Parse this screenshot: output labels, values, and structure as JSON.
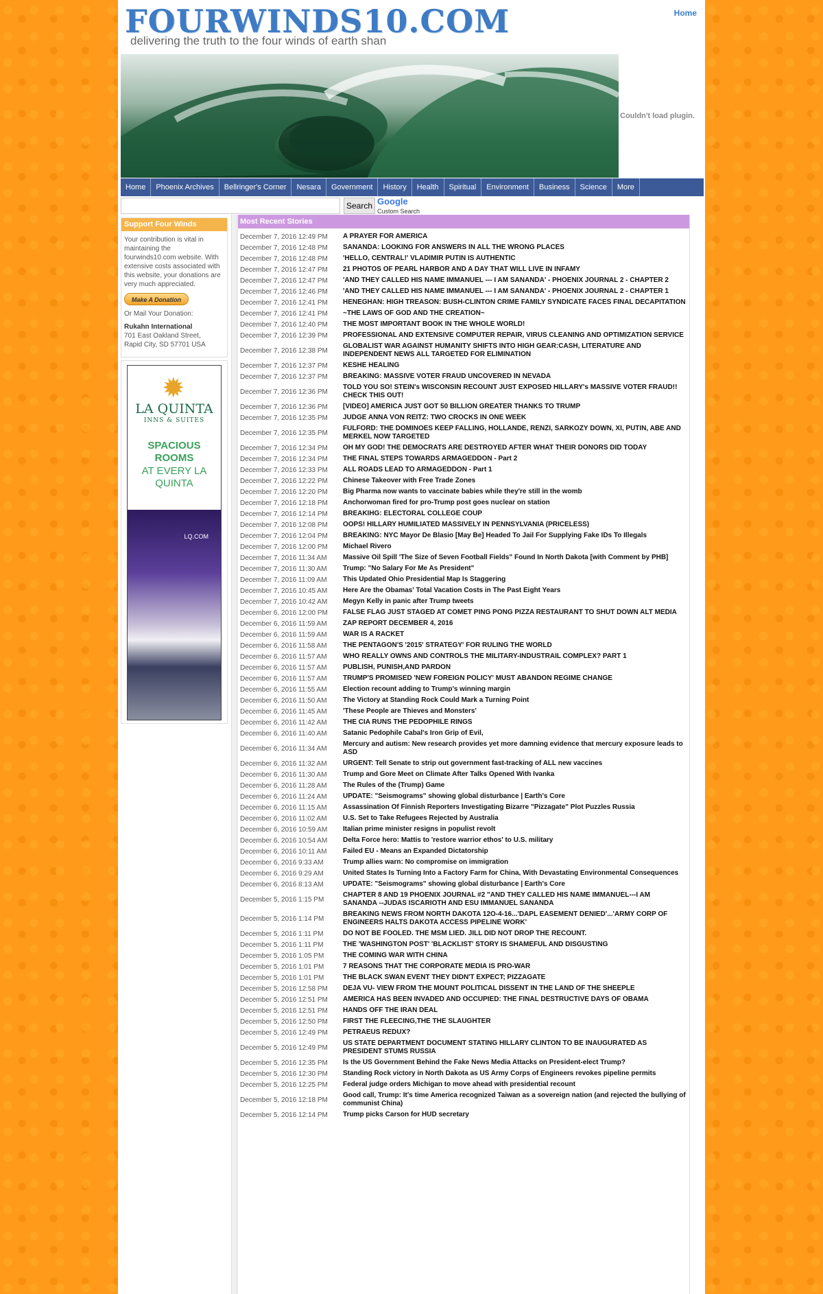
{
  "header": {
    "site_title": "FOURWINDS10.COM",
    "tagline": "delivering the truth to the four winds of earth shan",
    "home_link": "Home",
    "plugin_message": "Couldn't load plugin."
  },
  "nav": {
    "items": [
      "Home",
      "Phoenix Archives",
      "Bellringer's Corner",
      "Nesara",
      "Government",
      "History",
      "Health",
      "Spiritual",
      "Environment",
      "Business",
      "Science",
      "More"
    ]
  },
  "search": {
    "button_label": "Search",
    "google_label": "Google",
    "custom_label": "Custom Search"
  },
  "sidebar": {
    "title": "Support Four Winds",
    "intro": "Your contribution is vital in maintaining the fourwinds10.com website. With extensive costs associated with this website, your donations are very much appreciated.",
    "donate_label": "Make A Donation",
    "mail_label": "Or Mail Your Donation:",
    "address_name": "Rukahn International",
    "address_line1": "701 East Oakland Street,",
    "address_line2": "Rapid City, SD 57701 USA"
  },
  "ad": {
    "brand": "LA QUINTA",
    "brand_sub": "INNS & SUITES",
    "headline": "SPACIOUS ROOMS",
    "headline2": "AT EVERY LA QUINTA",
    "url": "LQ.COM"
  },
  "stories": {
    "title": "Most Recent Stories",
    "items": [
      {
        "date": "December 7, 2016 12:49 PM",
        "title": "A PRAYER FOR AMERICA"
      },
      {
        "date": "December 7, 2016 12:48 PM",
        "title": "SANANDA: LOOKING FOR ANSWERS IN ALL THE WRONG PLACES"
      },
      {
        "date": "December 7, 2016 12:48 PM",
        "title": "'HELLO, CENTRAL!' VLADIMIR PUTIN IS AUTHENTIC"
      },
      {
        "date": "December 7, 2016 12:47 PM",
        "title": "21 PHOTOS OF PEARL HARBOR AND A DAY THAT WILL LIVE IN INFAMY"
      },
      {
        "date": "December 7, 2016 12:47 PM",
        "title": "'AND THEY CALLED HIS NAME IMMANUEL --- I AM SANANDA' - PHOENIX JOURNAL 2 - CHAPTER 2"
      },
      {
        "date": "December 7, 2016 12:46 PM",
        "title": "'AND THEY CALLED HIS NAME IMMANUEL --- I AM SANANDA' - PHOENIX JOURNAL 2 - CHAPTER 1"
      },
      {
        "date": "December 7, 2016 12:41 PM",
        "title": "HENEGHAN: HIGH TREASON: BUSH-CLINTON CRIME FAMILY SYNDICATE FACES FINAL DECAPITATION"
      },
      {
        "date": "December 7, 2016 12:41 PM",
        "title": "~THE LAWS OF GOD AND THE CREATION~"
      },
      {
        "date": "December 7, 2016 12:40 PM",
        "title": "THE MOST IMPORTANT BOOK IN THE WHOLE WORLD!"
      },
      {
        "date": "December 7, 2016 12:39 PM",
        "title": "PROFESSIONAL AND EXTENSIVE COMPUTER REPAIR, VIRUS CLEANING AND OPTIMIZATION SERVICE"
      },
      {
        "date": "December 7, 2016 12:38 PM",
        "title": "GLOBALIST WAR AGAINST HUMANITY SHIFTS INTO HIGH GEAR:CASH, LITERATURE AND INDEPENDENT NEWS ALL TARGETED FOR ELIMINATION"
      },
      {
        "date": "December 7, 2016 12:37 PM",
        "title": "KESHE HEALING"
      },
      {
        "date": "December 7, 2016 12:37 PM",
        "title": "BREAKING: MASSIVE VOTER FRAUD UNCOVERED IN NEVADA"
      },
      {
        "date": "December 7, 2016 12:36 PM",
        "title": "TOLD YOU SO! STEIN's WISCONSIN RECOUNT JUST EXPOSED HILLARY's MASSIVE VOTER FRAUD!! CHECK THIS OUT!"
      },
      {
        "date": "December 7, 2016 12:36 PM",
        "title": "[VIDEO] AMERICA JUST GOT 50 BILLION GREATER THANKS TO TRUMP"
      },
      {
        "date": "December 7, 2016 12:35 PM",
        "title": "JUDGE ANNA VON REITZ: TWO CROCKS IN ONE WEEK"
      },
      {
        "date": "December 7, 2016 12:35 PM",
        "title": "FULFORD: THE DOMINOES KEEP FALLING, HOLLANDE, RENZI, SARKOZY DOWN, XI, PUTIN, ABE AND MERKEL NOW TARGETED"
      },
      {
        "date": "December 7, 2016 12:34 PM",
        "title": "OH MY GOD! THE DEMOCRATS ARE DESTROYED AFTER WHAT THEIR DONORS DID TODAY"
      },
      {
        "date": "December 7, 2016 12:34 PM",
        "title": "THE FINAL STEPS TOWARDS ARMAGEDDON - Part 2"
      },
      {
        "date": "December 7, 2016 12:33 PM",
        "title": "ALL ROADS LEAD TO ARMAGEDDON - Part 1"
      },
      {
        "date": "December 7, 2016 12:22 PM",
        "title": "Chinese Takeover with Free Trade Zones"
      },
      {
        "date": "December 7, 2016 12:20 PM",
        "title": "Big Pharma now wants to vaccinate babies while they're still in the womb"
      },
      {
        "date": "December 7, 2016 12:18 PM",
        "title": "Anchorwoman fired for pro-Trump post goes nuclear on station"
      },
      {
        "date": "December 7, 2016 12:14 PM",
        "title": "BREAKIHG: ELECTORAL COLLEGE COUP"
      },
      {
        "date": "December 7, 2016 12:08 PM",
        "title": "OOPS! HILLARY HUMILIATED MASSIVELY IN PENNSYLVANIA (PRICELESS)"
      },
      {
        "date": "December 7, 2016 12:04 PM",
        "title": "BREAKING: NYC Mayor De Blasio [May Be] Headed To Jail For Supplying Fake IDs To Illegals"
      },
      {
        "date": "December 7, 2016 12:00 PM",
        "title": "Michael Rivero"
      },
      {
        "date": "December 7, 2016 11:34 AM",
        "title": "Massive Oil Spill 'The Size of Seven Football Fields\" Found In North Dakota [with Comment by PHB]"
      },
      {
        "date": "December 7, 2016 11:30 AM",
        "title": "Trump: \"No Salary For Me As President\""
      },
      {
        "date": "December 7, 2016 11:09 AM",
        "title": "This Updated Ohio Presidential Map Is Staggering"
      },
      {
        "date": "December 7, 2016 10:45 AM",
        "title": "Here Are the Obamas' Total Vacation Costs in The Past Eight Years"
      },
      {
        "date": "December 7, 2016 10:42 AM",
        "title": "Megyn Kelly in panic after Trump tweets"
      },
      {
        "date": "December 6, 2016 12:00 PM",
        "title": "FALSE FLAG JUST STAGED AT COMET PING PONG PIZZA RESTAURANT TO SHUT DOWN ALT MEDIA"
      },
      {
        "date": "December 6, 2016 11:59 AM",
        "title": "ZAP REPORT DECEMBER 4, 2016"
      },
      {
        "date": "December 6, 2016 11:59 AM",
        "title": "WAR IS A RACKET"
      },
      {
        "date": "December 6, 2016 11:58 AM",
        "title": "THE PENTAGON'S '2015' STRATEGY' FOR RULING THE WORLD"
      },
      {
        "date": "December 6, 2016 11:57 AM",
        "title": "WHO REALLY OWNS AND CONTROLS THE MILITARY-INDUSTRAIL COMPLEX? PART 1"
      },
      {
        "date": "December 6, 2016 11:57 AM",
        "title": "PUBLISH, PUNISH,AND PARDON"
      },
      {
        "date": "December 6, 2016 11:57 AM",
        "title": "TRUMP'S PROMISED 'NEW FOREIGN POLICY' MUST ABANDON REGIME CHANGE"
      },
      {
        "date": "December 6, 2016 11:55 AM",
        "title": "Election recount adding to Trump's winning margin"
      },
      {
        "date": "December 6, 2016 11:50 AM",
        "title": "The Victory at Standing Rock Could Mark a Turning Point"
      },
      {
        "date": "December 6, 2016 11:45 AM",
        "title": "'These People are Thieves and Monsters'"
      },
      {
        "date": "December 6, 2016 11:42 AM",
        "title": "THE CIA RUNS THE PEDOPHILE RINGS"
      },
      {
        "date": "December 6, 2016 11:40 AM",
        "title": "Satanic Pedophile Cabal's Iron Grip of Evil,"
      },
      {
        "date": "December 6, 2016 11:34 AM",
        "title": "Mercury and autism: New research provides yet more damning evidence that mercury exposure leads to ASD"
      },
      {
        "date": "December 6, 2016 11:32 AM",
        "title": "URGENT: Tell Senate to strip out government fast-tracking of ALL new vaccines"
      },
      {
        "date": "December 6, 2016 11:30 AM",
        "title": "Trump and Gore Meet on Climate After Talks Opened With Ivanka"
      },
      {
        "date": "December 6, 2016 11:28 AM",
        "title": "The Rules of the (Trump) Game"
      },
      {
        "date": "December 6, 2016 11:24 AM",
        "title": "UPDATE: \"Seismograms\" showing global disturbance | Earth's Core"
      },
      {
        "date": "December 6, 2016 11:15 AM",
        "title": "Assassination Of Finnish Reporters Investigating Bizarre \"Pizzagate\" Plot Puzzles Russia"
      },
      {
        "date": "December 6, 2016 11:02 AM",
        "title": "U.S. Set to Take Refugees Rejected by Australia"
      },
      {
        "date": "December 6, 2016 10:59 AM",
        "title": "Italian prime minister resigns in populist revolt"
      },
      {
        "date": "December 6, 2016 10:54 AM",
        "title": "Delta Force hero: Mattis to 'restore warrior ethos' to U.S. military"
      },
      {
        "date": "December 6, 2016 10:11 AM",
        "title": "Failed EU - Means an Expanded Dictatorship"
      },
      {
        "date": "December 6, 2016 9:33 AM",
        "title": "Trump allies warn: No compromise on immigration"
      },
      {
        "date": "December 6, 2016 9:29 AM",
        "title": "United States Is Turning Into a Factory Farm for China, With Devastating Environmental Consequences"
      },
      {
        "date": "December 6, 2016 8:13 AM",
        "title": "UPDATE: \"Seismograms\" showing global disturbance | Earth's Core"
      },
      {
        "date": "December 5, 2016 1:15 PM",
        "title": "CHAPTER 8 AND 19 PHOENIX JOURNAL #2 \"AND THEY CALLED HIS NAME IMMANUEL---I AM SANANDA --JUDAS ISCARIOTH AND ESU IMMANUEL SANANDA"
      },
      {
        "date": "December 5, 2016 1:14 PM",
        "title": "BREAKING NEWS FROM NORTH DAKOTA 12O-4-16...'DAPL EASEMENT DENIED'...'ARMY CORP OF ENGINEERS HALTS DAKOTA ACCESS PIPELINE WORK'"
      },
      {
        "date": "December 5, 2016 1:11 PM",
        "title": "DO NOT BE FOOLED. THE MSM LIED. JILL DID NOT DROP THE RECOUNT."
      },
      {
        "date": "December 5, 2016 1:11 PM",
        "title": "THE 'WASHINGTON POST' 'BLACKLIST' STORY IS SHAMEFUL AND DISGUSTING"
      },
      {
        "date": "December 5, 2016 1:05 PM",
        "title": "THE COMING WAR WITH CHINA"
      },
      {
        "date": "December 5, 2016 1:01 PM",
        "title": "7 REASONS THAT THE CORPORATE MEDIA IS PRO-WAR"
      },
      {
        "date": "December 5, 2016 1:01 PM",
        "title": "THE BLACK SWAN EVENT THEY DIDN'T EXPECT; PIZZAGATE"
      },
      {
        "date": "December 5, 2016 12:58 PM",
        "title": "DEJA VU- VIEW FROM THE MOUNT POLITICAL DISSENT IN THE LAND OF THE SHEEPLE"
      },
      {
        "date": "December 5, 2016 12:51 PM",
        "title": "AMERICA HAS BEEN INVADED AND OCCUPIED: THE FINAL DESTRUCTIVE DAYS OF OBAMA"
      },
      {
        "date": "December 5, 2016 12:51 PM",
        "title": "HANDS OFF THE IRAN DEAL"
      },
      {
        "date": "December 5, 2016 12:50 PM",
        "title": "FIRST THE FLEECING,THE THE SLAUGHTER"
      },
      {
        "date": "December 5, 2016 12:49 PM",
        "title": "PETRAEUS REDUX?"
      },
      {
        "date": "December 5, 2016 12:49 PM",
        "title": "US STATE DEPARTMENT DOCUMENT STATING HILLARY CLINTON TO BE INAUGURATED AS PRESIDENT STUMS RUSSIA"
      },
      {
        "date": "December 5, 2016 12:35 PM",
        "title": "Is the US Government Behind the Fake News Media Attacks on President-elect Trump?"
      },
      {
        "date": "December 5, 2016 12:30 PM",
        "title": "Standing Rock victory in North Dakota as US Army Corps of Engineers revokes pipeline permits"
      },
      {
        "date": "December 5, 2016 12:25 PM",
        "title": "Federal judge orders Michigan to move ahead with presidential recount"
      },
      {
        "date": "December 5, 2016 12:18 PM",
        "title": "Good call, Trump: It's time America recognized Taiwan as a sovereign nation (and rejected the bullying of communist China)"
      },
      {
        "date": "December 5, 2016 12:14 PM",
        "title": "Trump picks Carson for HUD secretary"
      }
    ]
  }
}
